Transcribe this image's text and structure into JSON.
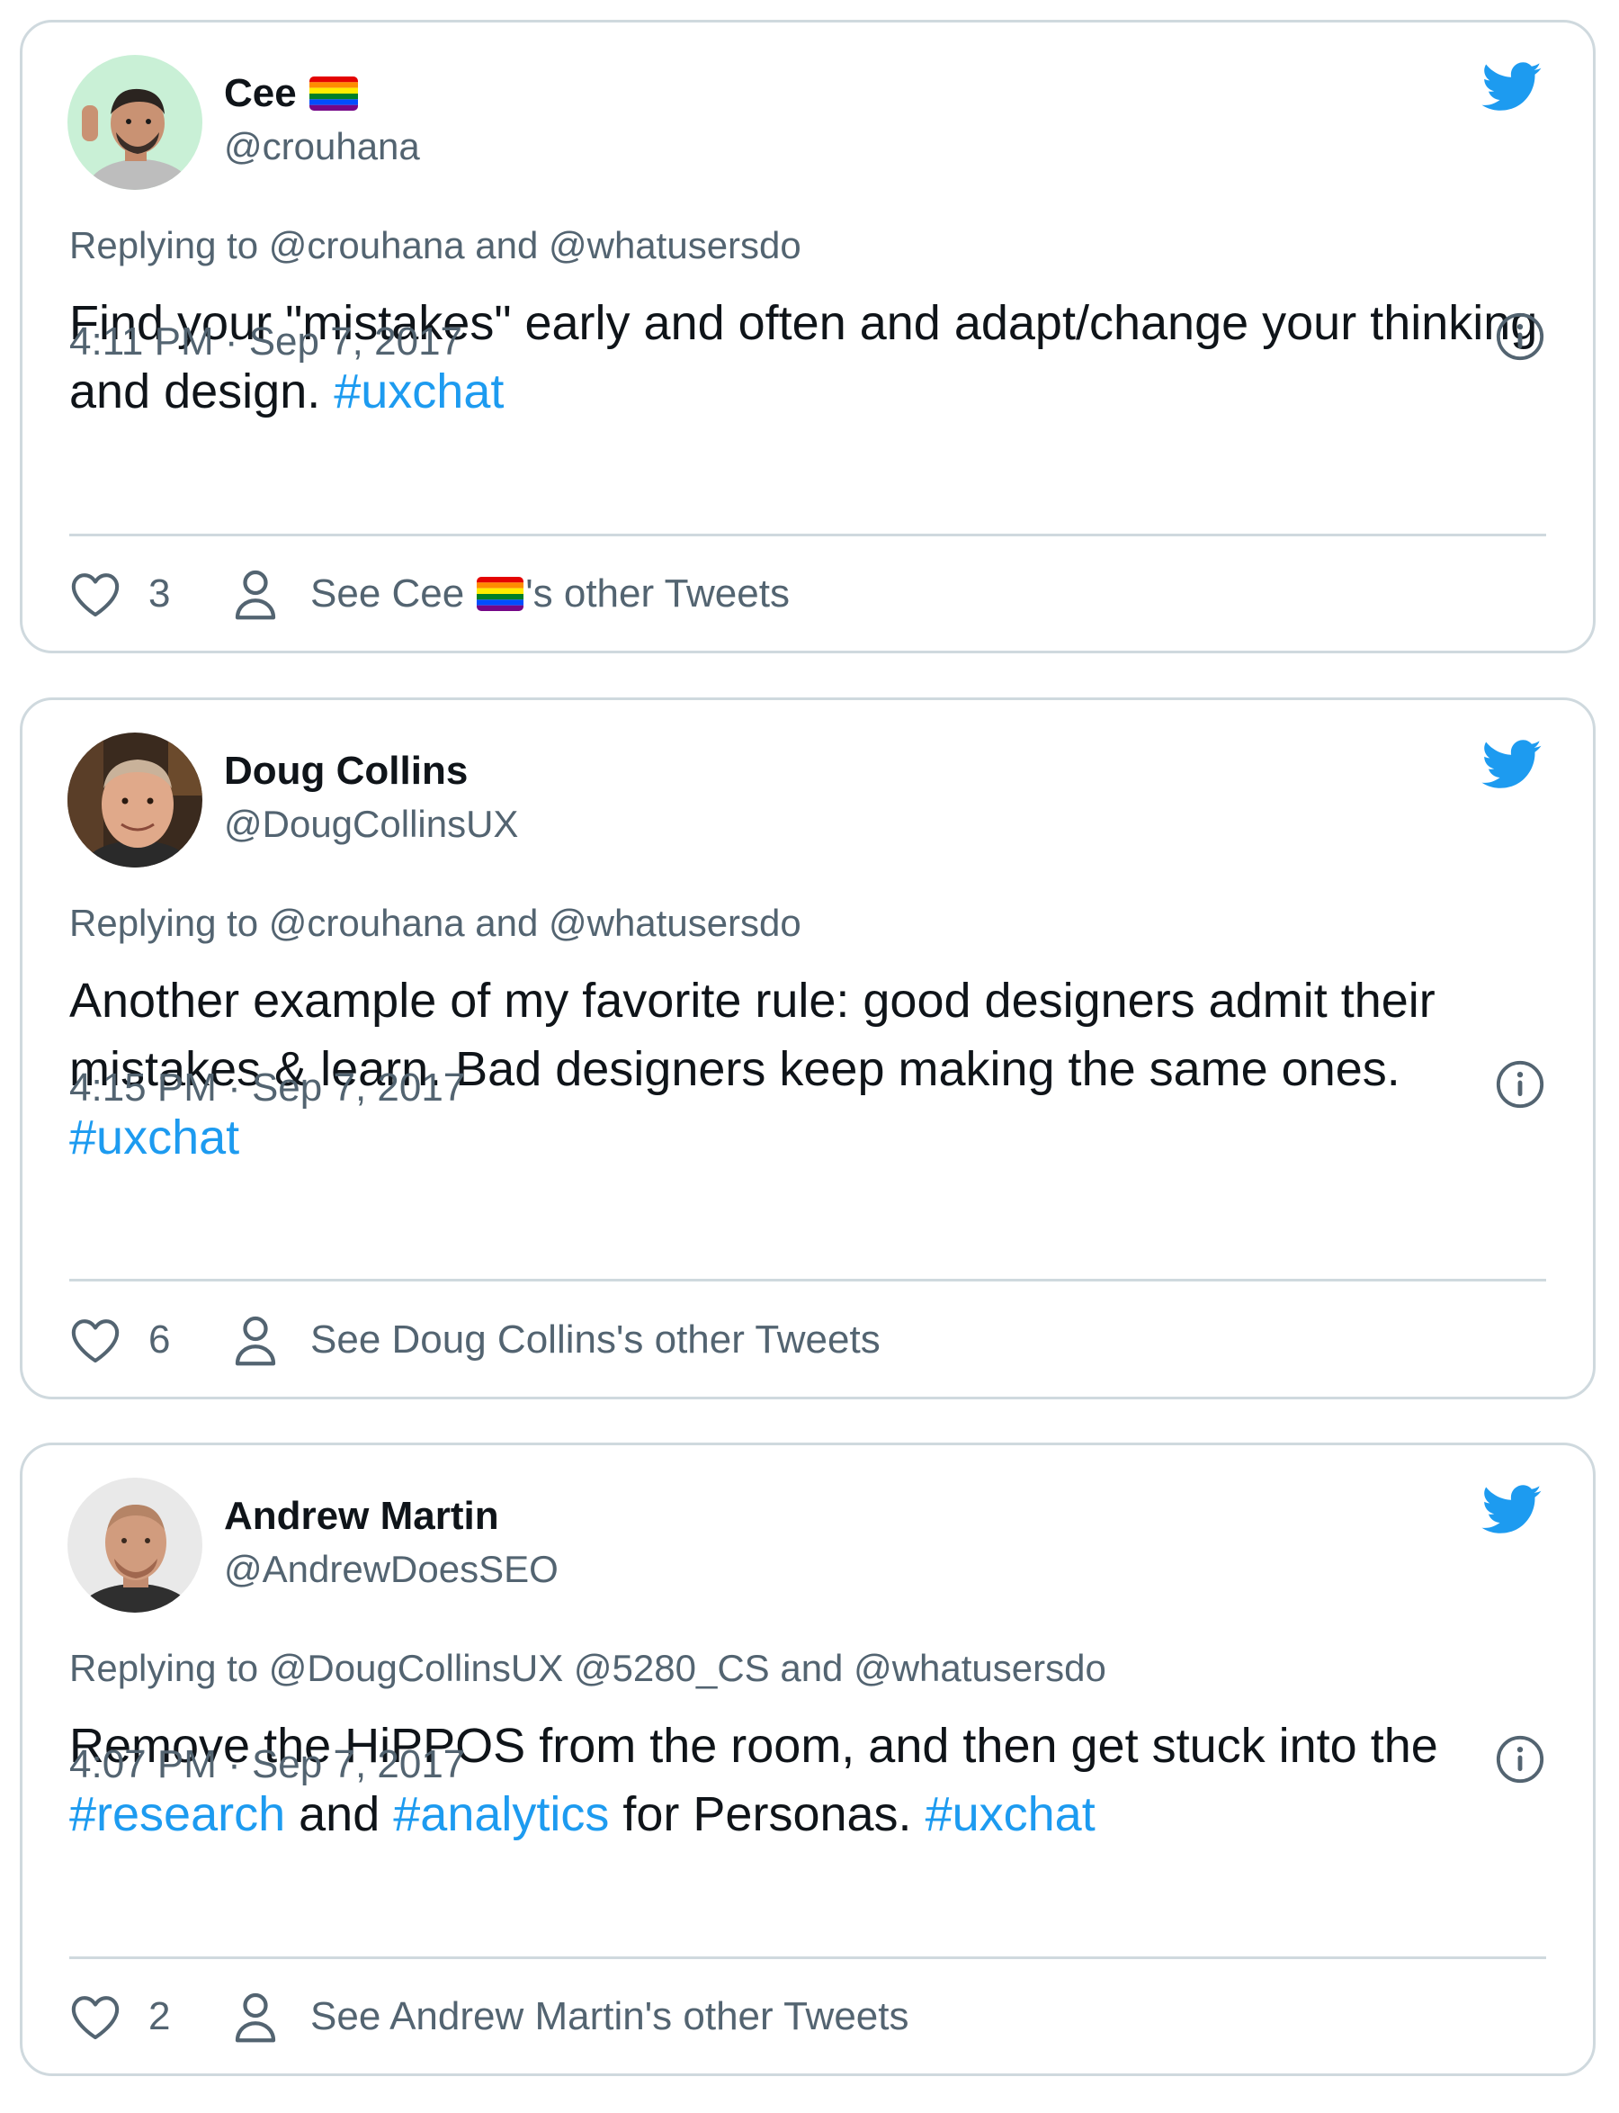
{
  "tweets": [
    {
      "display_name": "Cee",
      "has_rainbow_flag": true,
      "handle": "@crouhana",
      "replying_prefix": "Replying to",
      "replying_targets": "@crouhana and @whatusersdo",
      "body_plain_1": "Find your \"mistakes\" early and often and adapt/change your thinking and design. ",
      "hashtag_1": "#uxchat",
      "timestamp": "4:11 PM · Sep 7, 2017",
      "likes": "3",
      "see_prefix": "See Cee",
      "see_suffix": "'s other Tweets",
      "avatar_bg": "#c9f0d6"
    },
    {
      "display_name": "Doug Collins",
      "has_rainbow_flag": false,
      "handle": "@DougCollinsUX",
      "replying_prefix": "Replying to",
      "replying_targets": "@crouhana and @whatusersdo",
      "body_plain_1": "Another example of my favorite rule: good designers admit their mistakes & learn. Bad designers keep making the same ones. ",
      "hashtag_1": "#uxchat",
      "timestamp": "4:15 PM · Sep 7, 2017",
      "likes": "6",
      "see_text": "See Doug Collins's other Tweets",
      "avatar_bg": "#3a2a1e"
    },
    {
      "display_name": "Andrew Martin",
      "has_rainbow_flag": false,
      "handle": "@AndrewDoesSEO",
      "replying_prefix": "Replying to",
      "replying_targets": "@DougCollinsUX @5280_CS and @whatusersdo",
      "body_plain_1": "Remove the HiPPOS from the room, and then get stuck into the ",
      "hashtag_1": "#research",
      "body_plain_2": " and ",
      "hashtag_2": "#analytics",
      "body_plain_3": " for Personas. ",
      "hashtag_3": "#uxchat",
      "timestamp": "4:07 PM · Sep 7, 2017",
      "likes": "2",
      "see_text": "See Andrew Martin's other Tweets",
      "avatar_bg": "#e9e9e9"
    }
  ],
  "icons": {
    "brand": "twitter-bird-icon",
    "info": "info-icon",
    "like": "heart-icon",
    "profile": "person-icon",
    "flag": "rainbow-flag-icon"
  },
  "colors": {
    "brand_blue": "#1d9bf0",
    "text_primary": "#0f1419",
    "text_secondary": "#536471",
    "border": "#cfd9de"
  }
}
